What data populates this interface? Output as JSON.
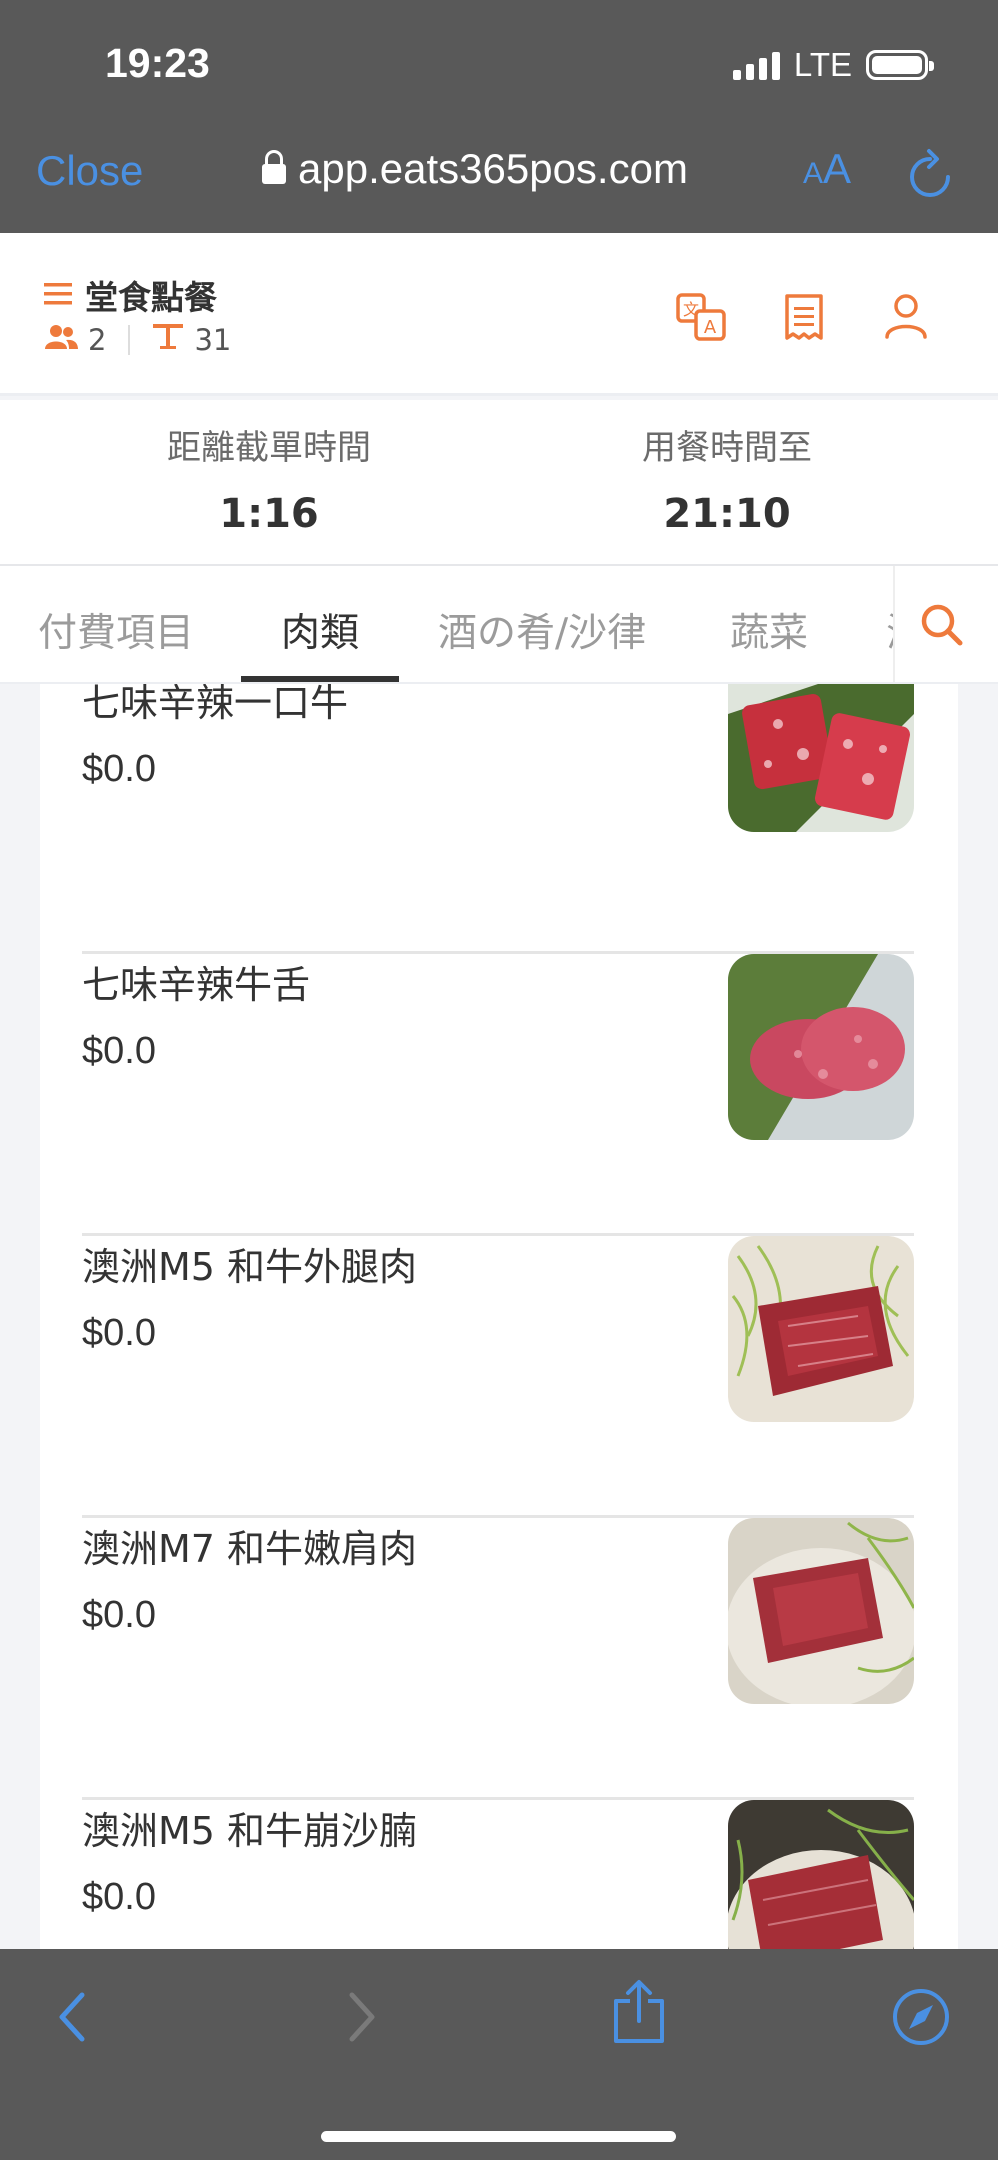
{
  "status": {
    "time": "19:23",
    "network": "LTE"
  },
  "browser": {
    "close_label": "Close",
    "url": "app.eats365pos.com",
    "aa_small": "A",
    "aa_big": "A"
  },
  "header": {
    "title": "堂食點餐",
    "guests": "2",
    "table": "31"
  },
  "timers": {
    "cutoff_label": "距離截單時間",
    "cutoff_value": "1:16",
    "dining_label": "用餐時間至",
    "dining_value": "21:10"
  },
  "tabs": [
    {
      "label": "付費項目"
    },
    {
      "label": "肉類"
    },
    {
      "label": "酒の肴/沙律"
    },
    {
      "label": "蔬菜"
    },
    {
      "label": "海"
    }
  ],
  "items": [
    {
      "name": "七味辛辣一口牛",
      "price": "$0.0"
    },
    {
      "name": "七味辛辣牛舌",
      "price": "$0.0"
    },
    {
      "name": "澳洲M5 和牛外腿肉",
      "price": "$0.0"
    },
    {
      "name": "澳洲M7 和牛嫩肩肉",
      "price": "$0.0"
    },
    {
      "name": "澳洲M5 和牛崩沙腩",
      "price": "$0.0"
    }
  ],
  "colors": {
    "accent": "#ee7a3c",
    "ios_blue": "#4a90e2",
    "chrome": "#595959"
  }
}
